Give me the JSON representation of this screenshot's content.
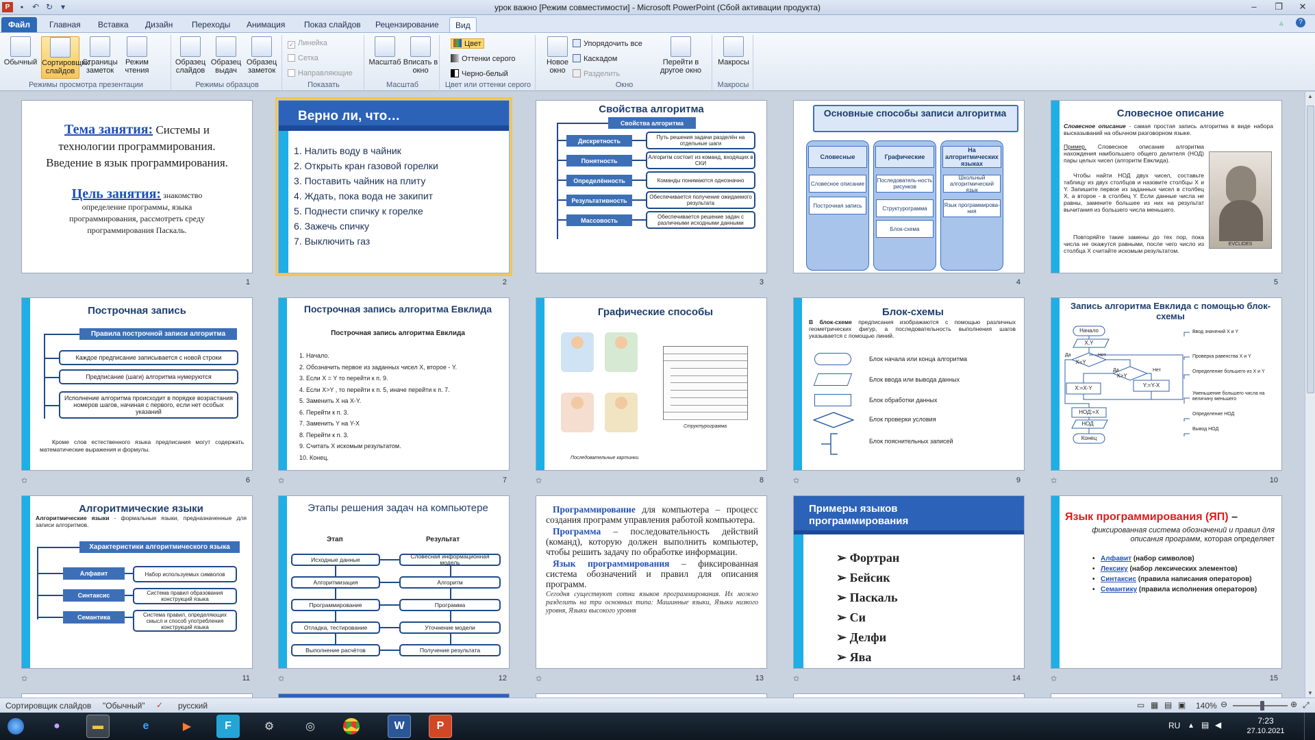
{
  "window": {
    "title": "урок важно [Режим совместимости]  -  Microsoft PowerPoint (Сбой активации продукта)"
  },
  "tabs": [
    "Файл",
    "Главная",
    "Вставка",
    "Дизайн",
    "Переходы",
    "Анимация",
    "Показ слайдов",
    "Рецензирование",
    "Вид"
  ],
  "ribbon": {
    "views": {
      "normal": "Обычный",
      "sorter": "Сортировщик слайдов",
      "notes": "Страницы заметок",
      "reading": "Режим чтения",
      "label": "Режимы просмотра презентации"
    },
    "masters": {
      "slide": "Образец слайдов",
      "handout": "Образец выдач",
      "notes": "Образец заметок",
      "label": "Режимы образцов"
    },
    "show": {
      "ruler": "Линейка",
      "grid": "Сетка",
      "guides": "Направляющие",
      "label": "Показать"
    },
    "zoom": {
      "zoom": "Масштаб",
      "fit": "Вписать в окно",
      "label": "Масштаб"
    },
    "color": {
      "color": "Цвет",
      "gray": "Оттенки серого",
      "bw": "Черно-белый",
      "label": "Цвет или оттенки серого"
    },
    "window": {
      "new": "Новое окно",
      "arrange": "Упорядочить все",
      "cascade": "Каскадом",
      "split": "Разделить",
      "switch": "Перейти в другое окно",
      "label": "Окно"
    },
    "macros": {
      "macros": "Макросы",
      "label": "Макросы"
    }
  },
  "slides": {
    "s1": {
      "n": "1",
      "topic_label": "Тема занятия:",
      "topic": " Системы и технологии программирования. Введение в язык программирования.",
      "goal_label": "Цель занятия:",
      "goal": " знакомство определение программы, языка программирования, рассмотреть среду программирования Паскаль."
    },
    "s2": {
      "n": "2",
      "title": "Верно ли, что…",
      "items": [
        "1.  Налить воду в чайник",
        "2.  Открыть кран газовой горелки",
        "3.  Поставить чайник на плиту",
        "4.  Ждать, пока вода не закипит",
        "5.  Поднести спичку к горелке",
        "6.  Зажечь спичку",
        "7.  Выключить газ"
      ]
    },
    "s3": {
      "n": "3",
      "title": "Свойства алгоритма",
      "head": "Свойства алгоритма",
      "props": [
        "Дискретность",
        "Понятность",
        "Определённость",
        "Результативность",
        "Массовость"
      ],
      "descs": [
        "Путь решения задачи разделён на отдельные шаги",
        "Алгоритм состоит из команд, входящих в СКИ",
        "Команды понимаются однозначно",
        "Обеспечивается получение ожидаемого результата",
        "Обеспечивается решение задач с различными исходными данными"
      ]
    },
    "s4": {
      "n": "4",
      "title": "Основные способы записи алгоритма",
      "cols": [
        "Словесные",
        "Графические",
        "На алгоритмических языках"
      ],
      "c1": [
        "Словесное описание",
        "Построчная запись"
      ],
      "c2": [
        "Последователь-ность рисунков",
        "Структурограмма",
        "Блок-схема"
      ],
      "c3": [
        "Школьный алгоритмический язык",
        "Язык программирова-ния"
      ]
    },
    "s5": {
      "n": "5",
      "title": "Словесное описание",
      "p1b": "Словесное описание",
      "p1": " - самая простая запись алгоритма в виде набора высказываний на обычном разговорном языке.",
      "p2u": "Пример.",
      "p2": " Словесное описание алгоритма нахождения наибольшего общего делителя (НОД) пары целых чисел (алгоритм Евклида).",
      "p3": "Чтобы найти НОД двух чисел, составьте таблицу из двух столбцов и назовите столбцы X и Y. Запишите первое из заданных чисел в столбец X, а второе - в столбец Y. Если данные числа не равны, замените большее из них на результат вычитания из большего числа меньшего.",
      "p4": "Повторяйте такие замены до тех пор, пока числа не окажутся равными, после чего число из столбца X считайте искомым результатом.",
      "caption": "EVCLIDES"
    },
    "s6": {
      "n": "6",
      "title": "Построчная запись",
      "head": "Правила построчной записи алгоритма",
      "rules": [
        "Каждое предписание записывается с новой строки",
        "Предписание (шаги) алгоритма нумеруются",
        "Исполнение алгоритма происходит в порядке возрастания номеров шагов, начиная с первого, если нет особых указаний"
      ],
      "note": "Кроме слов естественного языка предписания могут содержать математические выражения и формулы."
    },
    "s7": {
      "n": "7",
      "title": "Построчная запись алгоритма Евклида",
      "sub": "Построчная запись алгоритма Евклида",
      "steps": [
        "1. Начало.",
        "2. Обозначить первое из заданных чисел X, второе - Y.",
        "3. Если X = Y то перейти к п. 9.",
        "4. Если X>Y , то перейти к п. 5, иначе перейти к п. 7.",
        "5. Заменить X на X-Y.",
        "6. Перейти к п. 3.",
        "7. Заменить  Y на Y-X",
        "8. Перейти к п. 3.",
        "9. Считать X искомым результатом.",
        "10. Конец."
      ]
    },
    "s8": {
      "n": "8",
      "title": "Графические способы",
      "cap1": "Последовательные  картинки",
      "cap2": "Структурограмма"
    },
    "s9": {
      "n": "9",
      "title": "Блок-схемы",
      "intro_b": "В блок-схеме",
      "intro": " предписания изображаются с помощью различных геометрических фигур, а последовательность выполнения шагов указывается с помощью линий.",
      "items": [
        "Блок начала или конца алгоритма",
        "Блок ввода или вывода данных",
        "Блок обработки данных",
        "Блок проверки условия",
        "Блок пояснительных записей"
      ]
    },
    "s10": {
      "n": "10",
      "title": "Запись алгоритма Евклида с помощью блок-схемы",
      "nodes": [
        "Начало",
        "X,Y",
        "X=Y",
        "X>Y",
        "X:=X-Y",
        "Y:=Y-X",
        "НОД:=X",
        "НОД",
        "Конец"
      ],
      "yes": "Да",
      "no": "Нет",
      "notes": [
        "Ввод значений X и Y",
        "Проверка равенства X и Y",
        "Определение большего из X и Y",
        "Уменьшение большего числа на величину меньшего",
        "Определение НОД",
        "Вывод НОД"
      ]
    },
    "s11": {
      "n": "11",
      "title": "Алгоритмические языки",
      "intro_b": "Алгоритмические языки",
      "intro": " - формальные языки, предназначенные для записи алгоритмов.",
      "head": "Характеристики алгоритмического языка",
      "keys": [
        "Алфавит",
        "Синтаксис",
        "Семантика"
      ],
      "vals": [
        "Набор используемых символов",
        "Система правил образования конструкций языка",
        "Система правил, определяющих смысл и способ употребления конструкций языка"
      ]
    },
    "s12": {
      "n": "12",
      "title": "Этапы решения задач на компьютере",
      "h1": "Этап",
      "h2": "Результат",
      "left": [
        "Исходные данные",
        "Алгоритмизация",
        "Программирование",
        "Отладка, тестирование",
        "Выполнение расчётов"
      ],
      "right": [
        "Словесная информационная модель",
        "Алгоритм",
        "Программа",
        "Уточнение модели",
        "Получение результата"
      ]
    },
    "s13": {
      "n": "13",
      "t1b": "Программирование",
      "t1": " для компьютера – процесс создания программ управления работой компьютера.",
      "t2b": "Программа",
      "t2": " – последовательность действий (команд), которую должен выполнить компьютер, чтобы решить задачу по обработке информации.",
      "t3b": "Язык программирования",
      "t3": " – фиксированная система обозначений и правил для описания программ.",
      "t4": "Сегодня существуют сотни языков программирования. Их можно разделить на три основных типа: Машинные языки, Языки низкого уровня, Языки высокого уровня"
    },
    "s14": {
      "n": "14",
      "title": "Примеры языков программирования",
      "langs": [
        "Фортран",
        "Бейсик",
        "Паскаль",
        "Си",
        "Делфи",
        "Ява"
      ]
    },
    "s15": {
      "n": "15",
      "title": "Язык программирования (ЯП)",
      "dash": " –",
      "def": "фиксированная система обозначений и правил для описания программ,",
      "def2": " которая определяет",
      "items": [
        {
          "u": "Алфавит",
          "t": " (набор символов)"
        },
        {
          "u": "Лексику",
          "t": " (набор лексических элементов)"
        },
        {
          "u": "Синтаксис",
          "t": " (правила написания операторов)"
        },
        {
          "u": "Семантику",
          "t": " (правила исполнения операторов)"
        }
      ]
    }
  },
  "status": {
    "view": "Сортировщик слайдов",
    "theme": "\"Обычный\"",
    "lang": "русский",
    "zoom": "140%"
  },
  "taskbar": {
    "lang": "RU",
    "time": "7:23",
    "date": "27.10.2021"
  }
}
